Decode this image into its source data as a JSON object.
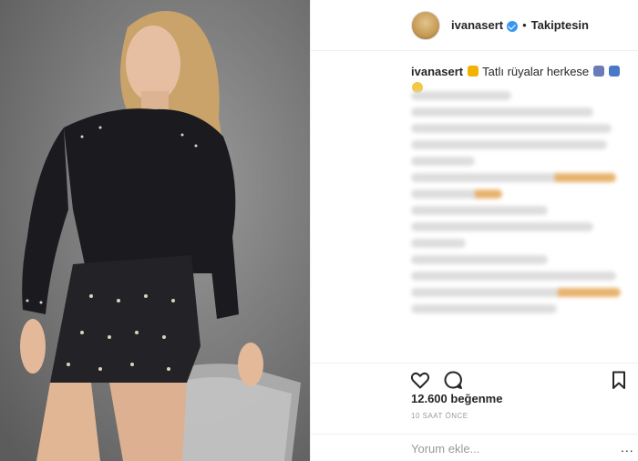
{
  "header": {
    "username": "ivanasert",
    "verified": true,
    "separator": "•",
    "follow_status": "Takiptesin"
  },
  "caption": {
    "username": "ivanasert",
    "text": "Tatlı rüyalar herkese"
  },
  "comments": {
    "blurred": true,
    "count_visible_lines": 14
  },
  "actions": {
    "like_icon": "heart-icon",
    "comment_icon": "comment-icon",
    "save_icon": "bookmark-icon"
  },
  "likes": {
    "label": "12.600 beğenme"
  },
  "time": {
    "label": "10 SAAT ÖNCE"
  },
  "comment_box": {
    "placeholder": "Yorum ekle...",
    "more": "..."
  },
  "colors": {
    "verified": "#3897f0",
    "text": "#262626",
    "muted": "#999999",
    "border": "#efefef"
  }
}
